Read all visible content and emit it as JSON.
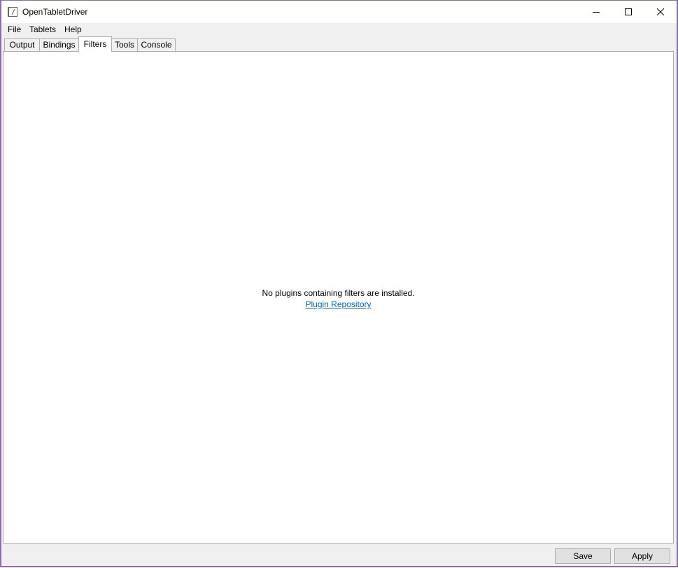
{
  "window": {
    "title": "OpenTabletDriver",
    "icon": "app-icon"
  },
  "menu": {
    "file": "File",
    "tablets": "Tablets",
    "help": "Help"
  },
  "tabs": [
    {
      "label": "Output",
      "active": false
    },
    {
      "label": "Bindings",
      "active": false
    },
    {
      "label": "Filters",
      "active": true
    },
    {
      "label": "Tools",
      "active": false
    },
    {
      "label": "Console",
      "active": false
    }
  ],
  "filters_panel": {
    "empty_message": "No plugins containing filters are installed.",
    "repo_link": "Plugin Repository"
  },
  "buttons": {
    "save": "Save",
    "apply": "Apply"
  },
  "colors": {
    "window_border": "#8e6bab",
    "link": "#0066cc",
    "chrome_background": "#f0f0f0"
  }
}
